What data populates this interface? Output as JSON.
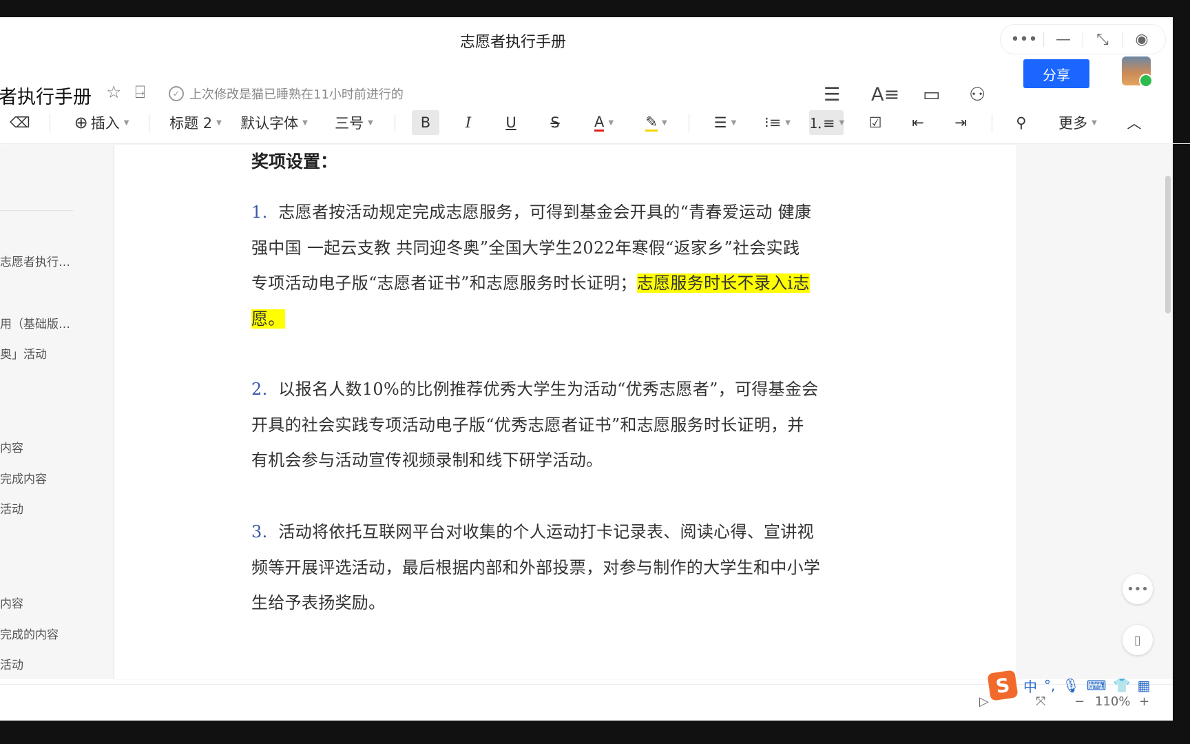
{
  "window": {
    "title": "志愿者执行手册"
  },
  "doc": {
    "name": "者执行手册",
    "last_modified": "上次修改是猫已睡熟在11小时前进行的",
    "share_label": "分享"
  },
  "toolbar": {
    "insert": "插入",
    "heading": "标题 2",
    "font": "默认字体",
    "size": "三号",
    "more": "更多"
  },
  "sidebar": {
    "items": [
      "志愿者执行…",
      "用（基础版…",
      "奥」活动",
      "内容",
      "完成内容",
      "活动",
      "内容",
      "完成的内容",
      "活动"
    ]
  },
  "content": {
    "heading": "奖项设置：",
    "paragraphs": [
      {
        "num": "1.",
        "text_lines": [
          "志愿者按活动规定完成志愿服务，可得到基金会开具的“青春爱运动 健康",
          "强中国 一起云支教 共同迎冬奥”全国大学生2022年寒假“返家乡”社会实践",
          "专项活动电子版“志愿者证书”和志愿服务时长证明；"
        ],
        "highlight_a": "志愿服务时长不录入i志",
        "highlight_b": "愿。"
      },
      {
        "num": "2.",
        "text_lines": [
          "以报名人数10%的比例推荐优秀大学生为活动“优秀志愿者”，可得基金会",
          "开具的社会实践专项活动电子版“优秀志愿者证书”和志愿服务时长证明，并",
          "有机会参与活动宣传视频录制和线下研学活动。"
        ]
      },
      {
        "num": "3.",
        "text_lines": [
          "活动将依托互联网平台对收集的个人运动打卡记录表、阅读心得、宣讲视",
          "频等开展评选活动，最后根据内部和外部投票，对参与制作的大学生和中小学",
          "生给予表扬奖励。"
        ]
      }
    ]
  },
  "status": {
    "zoom": "110%",
    "ime": [
      "中",
      "°,"
    ]
  },
  "colors": {
    "accent": "#1a66ff",
    "highlight": "#ffff00",
    "list_number": "#3a58a8"
  }
}
